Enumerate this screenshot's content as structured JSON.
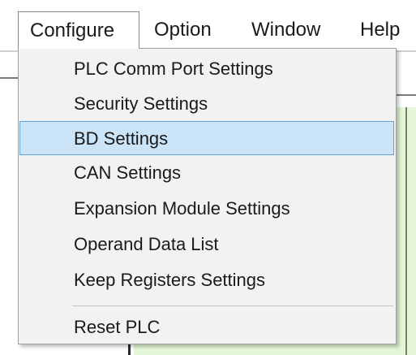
{
  "menubar": {
    "items": [
      {
        "label": "Configure",
        "active": true
      },
      {
        "label": "Option"
      },
      {
        "label": "Window"
      },
      {
        "label": "Help"
      }
    ]
  },
  "configure_menu": {
    "items": [
      {
        "label": "PLC Comm Port Settings"
      },
      {
        "label": "Security Settings"
      },
      {
        "label": "BD Settings",
        "highlighted": true
      },
      {
        "label": "CAN Settings"
      },
      {
        "label": "Expansion Module Settings"
      },
      {
        "label": "Operand Data List"
      },
      {
        "label": "Keep Registers Settings"
      },
      {
        "label": "Reset PLC"
      }
    ]
  },
  "colors": {
    "highlight_fill": "#cce4f7",
    "highlight_border": "#5aa3dd",
    "menu_background": "#f2f2f2",
    "app_panel": "#e4f7d6"
  }
}
